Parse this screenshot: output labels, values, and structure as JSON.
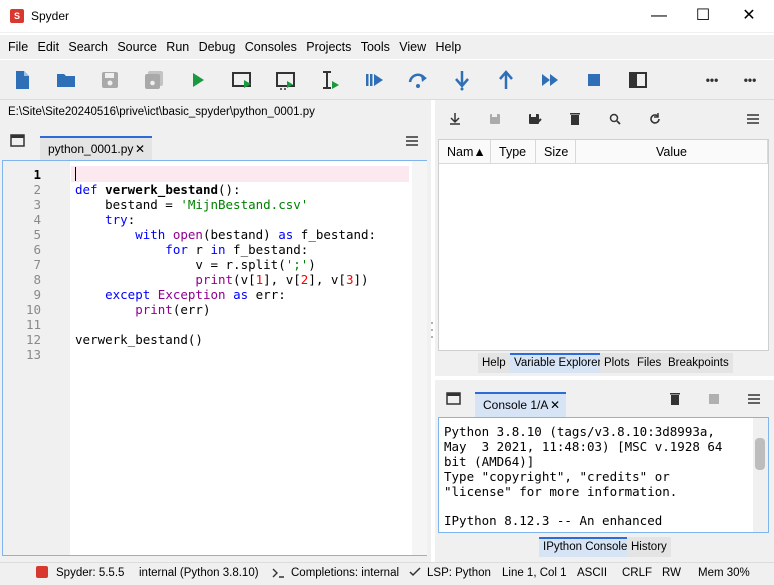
{
  "window": {
    "title": "Spyder",
    "app_icon_text": "S",
    "minimize": "—",
    "maximize": "☐",
    "close": "✕"
  },
  "menu": [
    "File",
    "Edit",
    "Search",
    "Source",
    "Run",
    "Debug",
    "Consoles",
    "Projects",
    "Tools",
    "View",
    "Help"
  ],
  "toolbar": {
    "icons": [
      "new-file-icon",
      "open-folder-icon",
      "save-icon",
      "save-all-icon",
      "run-icon",
      "run-cell-icon",
      "run-cell-advance-icon",
      "run-selection-icon",
      "debug-icon",
      "step-over-icon",
      "step-into-icon",
      "step-return-icon",
      "continue-icon",
      "stop-icon",
      "maximize-pane-icon"
    ],
    "more": "•••"
  },
  "editor": {
    "path": "E:\\Site\\Site20240516\\prive\\ict\\basic_spyder\\python_0001.py",
    "tab_label": "python_0001.py",
    "tab_close": "✕",
    "current_line": 1,
    "line_numbers": [
      "1",
      "2",
      "3",
      "4",
      "5",
      "6",
      "7",
      "8",
      "9",
      "10",
      "11",
      "12",
      "13"
    ]
  },
  "variable_explorer": {
    "columns": [
      "Nam▲",
      "Type",
      "Size",
      "Value"
    ],
    "tabs": [
      "Help",
      "Variable Explorer",
      "Plots",
      "Files",
      "Breakpoints"
    ],
    "active_tab": "Variable Explorer"
  },
  "console": {
    "tab_label": "Console 1/A",
    "tab_close": "✕",
    "lines": [
      "Python 3.8.10 (tags/v3.8.10:3d8993a,",
      "May  3 2021, 11:48:03) [MSC v.1928 64",
      "bit (AMD64)]",
      "Type \"copyright\", \"credits\" or",
      "\"license\" for more information.",
      "",
      "IPython 8.12.3 -- An enhanced"
    ],
    "tabs": [
      "IPython Console",
      "History"
    ],
    "active_tab": "IPython Console"
  },
  "statusbar": {
    "version": "Spyder: 5.5.5",
    "interpreter": "internal (Python 3.8.10)",
    "completions": "Completions: internal",
    "lsp": "LSP: Python",
    "position": "Line 1, Col 1",
    "encoding": "ASCII",
    "eol": "CRLF",
    "mode": "RW",
    "memory": "Mem 30%"
  },
  "colors": {
    "accent": "#2e6bd8",
    "toolbar_icon": "#2f6fb7",
    "run_green": "#1a9a3e",
    "string_green": "#008000",
    "keyword_blue": "#0000ff",
    "builtin_purple": "#900090"
  }
}
